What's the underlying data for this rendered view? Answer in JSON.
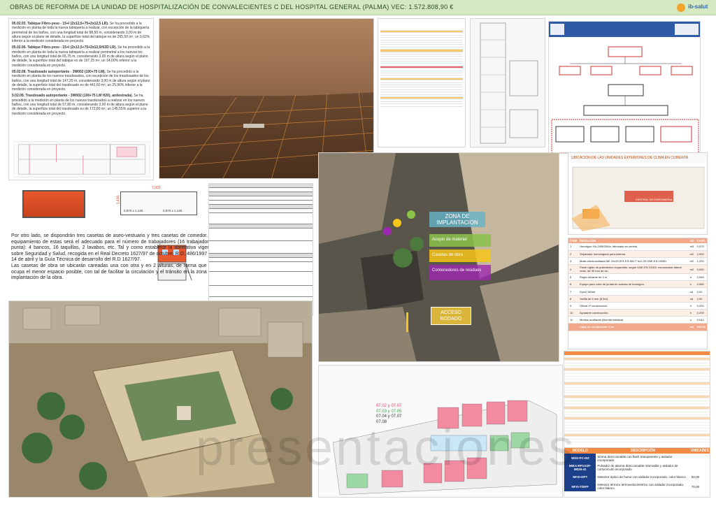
{
  "header": {
    "title": "OBRAS DE REFORMA DE LA UNIDAD DE HOSPITALIZACIÓN DE CONVALECIENTES C DEL HOSPITAL GENERAL (PALMA)   VEC: 1.572.808,90 €",
    "logo_text": "ib-salut"
  },
  "specs": [
    {
      "code": "05.02.03. Tabique Fibro-yeso - 15+I (2x12,5+75+2x12,5 LR).",
      "text": "Se ha procedido a la medición en planta de toda la nueva tabiquería a realizar, con excepción de la tabiquería perimetral de los baños, con una longitud total de 88,50 m, considerando 3,00 m de altura según el plano de detalle, la superficie total del tabique es de 265,50 m², un 0,62% inferior a la medición considerada en proyecto."
    },
    {
      "code": "05.02.06. Tabique Fibro-yeso - 15+I (2x12,5+75+2x12,5H/2D LR).",
      "text": "Se ha procedido a la medición en planta de toda la nueva tabiquería a realizar perimetral a los nuevos los baños, con una longitud total de 65,75 m, considerando 3,00 m de altura según el plano de detalle, la superficie total del tabique es de 197,25 m², un 14,00% inferior a la medición considerada en proyecto."
    },
    {
      "code": "05.02.08. Trasdosado autoportante - 3W002 (100+75 LM).",
      "text": "Se ha procedido a la medición en planta de los nuevos trasdosados, con excepción de los trasdosados de los baños, con una longitud total de 147,20 m, considerando 3,00 m de altura según el plano de detalle, la superficie total del trasdosado es de 441,60 m², un 25,96% inferior a la medición considerada en proyecto."
    },
    {
      "code": "5.02.09. Trasdosado autoportante - 3W002 (100+75 LM H20), antiestrada).",
      "text": "Se ha procedido a la medición en planta de los nuevos trasdosados a realizar en los nuevos baños, con una longitud total de 57,80 m, considerando 3,00 m de altura según el plano de detalle, la superficie total del trasdosado es de 172,80 m², un 145,55% superior a la medición considerada en proyecto."
    }
  ],
  "casetas": {
    "dim_width": "7,920",
    "dim_height": "1,430",
    "dim_a": "0,970 x 1,140",
    "dim_b": "0,970 x 1,140",
    "paragraph_1": "Por otro lado, se dispondrán tres casetas de aseo-vestuario y tres casetas de comedor. El equipamiento de estas será el adecuado para el número de trabajadores (16 trabajadores punta): 4 bancos, 16 taquillas, 2 lavabos, etc. Tal y como establece la normativa vigente sobre Seguridad y Salud, recogida en el Real Decreto 1627/97 de octubre, R.D. 486/1997 de 14 de abril y la Guía Técnica de desarrollo del R.D 1627/97.",
    "paragraph_2": "Las casetas de obra se ubicarán careadas una con otra y en 2 alturas, de forma que se ocupa el menor espacio posible, con tal de facilitar la circulación y el tránsito en la zona de implantación de la obra."
  },
  "zone_map": {
    "zone_title": "ZONA DE IMPLANTACION",
    "legend": [
      {
        "label": "Acopio de material",
        "color": "#8bc34a"
      },
      {
        "label": "Casetas de obra",
        "color": "#f5c518"
      },
      {
        "label": "Contenedores de residuos",
        "color": "#9c27b0"
      }
    ],
    "access_label": "ACCESO RODADO"
  },
  "climate": {
    "title": "UBICACIÓN DE LAS UNIDADES EXTERIORES DE CLIMA EN CUBIERTA",
    "label_1": "CENTRAL DE ENFERMERIA"
  },
  "mediciones": {
    "headers": [
      "ÍTEM",
      "DESGLOSE",
      "UD",
      "CANT."
    ],
    "rows": [
      [
        "1",
        "Hormigón HA-25/B/20/IIa, fabricado en central.",
        "m3",
        "0,070"
      ],
      [
        "2",
        "Separador homologado para soleras.",
        "m2",
        "2,000"
      ],
      [
        "3",
        "Malla electrosoldada ME 20x20 Ø 5-5 B 500 T 6x2,20 UNE-EN 10080.",
        "m2",
        "1,200"
      ],
      [
        "4",
        "Panel rígido de poliestireno expandido, según UNE-EN 13163, mecanizado lateral recto, de 30 mm de es.",
        "m2",
        "0,050"
      ],
      [
        "5",
        "Regla vibrante de 3 m.",
        "h",
        "0,084"
      ],
      [
        "6",
        "Equipo para corte de juntas en soleras de hormigón.",
        "h",
        "0,060"
      ],
      [
        "7",
        "Epoxi 380ml.",
        "ud",
        "0,02"
      ],
      [
        "8",
        "Varilla de 6 mm (6,5m)",
        "ud",
        "2,02"
      ],
      [
        "9",
        "Oficial 1ª construcción.",
        "h",
        "0,200"
      ],
      [
        "10",
        "Ayudante construcción.",
        "h",
        "0,200"
      ],
      [
        "11",
        "Medios auxiliares (Bomba estática)",
        "u",
        "0,042"
      ]
    ],
    "total": [
      "",
      "Capa de compresión 5 cm",
      "m2",
      "918,00"
    ]
  },
  "plan": {
    "legend": [
      "07.02 y 07.07",
      "07.03 y 07.05",
      "07.04 y 07.07",
      "07.08"
    ]
  },
  "detectors": {
    "headers": [
      "MODELO",
      "DESCRIPCIÓN",
      "UNIDADES"
    ],
    "rows": [
      [
        "WSS-PC-I02",
        "Sirena direccionable con flash transparente y aislador incorporado",
        ""
      ],
      [
        "MIEA-RP1G2F-M026-41",
        "Pulsador de alarma direccionable rearmable y aislador de cortocircuito incorporado",
        ""
      ],
      [
        "NFXI-OPT",
        "Detector óptico de humo con aislador incorporado, color blanco",
        "50,00"
      ],
      [
        "NFXI-TDIFF",
        "Detector térmico termovelocimétrico con aislador incorporado, color blanco.",
        "70,00"
      ]
    ]
  },
  "watermark": "presentaciones"
}
